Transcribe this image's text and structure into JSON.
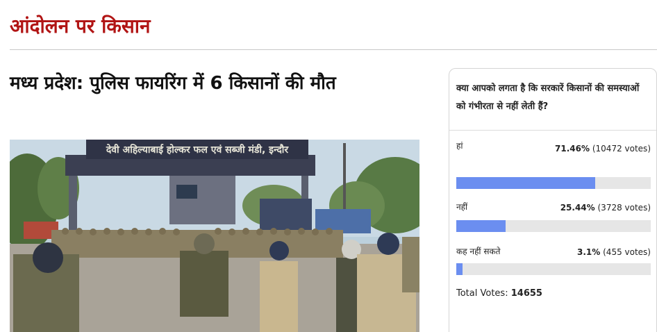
{
  "section": {
    "title": "आंदोलन पर किसान"
  },
  "article": {
    "headline": "मध्य प्रदेश: पुलिस फायरिंग में 6 किसानों की मौत",
    "photo_sign_text": "देवी अहिल्याबाई होल्कर फल एवं सब्जी मंडी, इन्दौर"
  },
  "poll": {
    "question": "क्या आपको लगता है कि सरकारें किसानों की समस्याओं को गंभीरता से नहीं लेती हैं?",
    "options": [
      {
        "label": "हां",
        "percent_text": "71.46%",
        "votes_text": "(10472 votes)",
        "percent": 71.46
      },
      {
        "label": "नहीं",
        "percent_text": "25.44%",
        "votes_text": "(3728 votes)",
        "percent": 25.44
      },
      {
        "label": "कह नहीं सकते",
        "percent_text": "3.1%",
        "votes_text": "(455 votes)",
        "percent": 3.1
      }
    ],
    "total_label": "Total Votes:",
    "total_value": "14655",
    "bar_color": "#6b8ef0"
  },
  "colors": {
    "section_title": "#b11414"
  }
}
